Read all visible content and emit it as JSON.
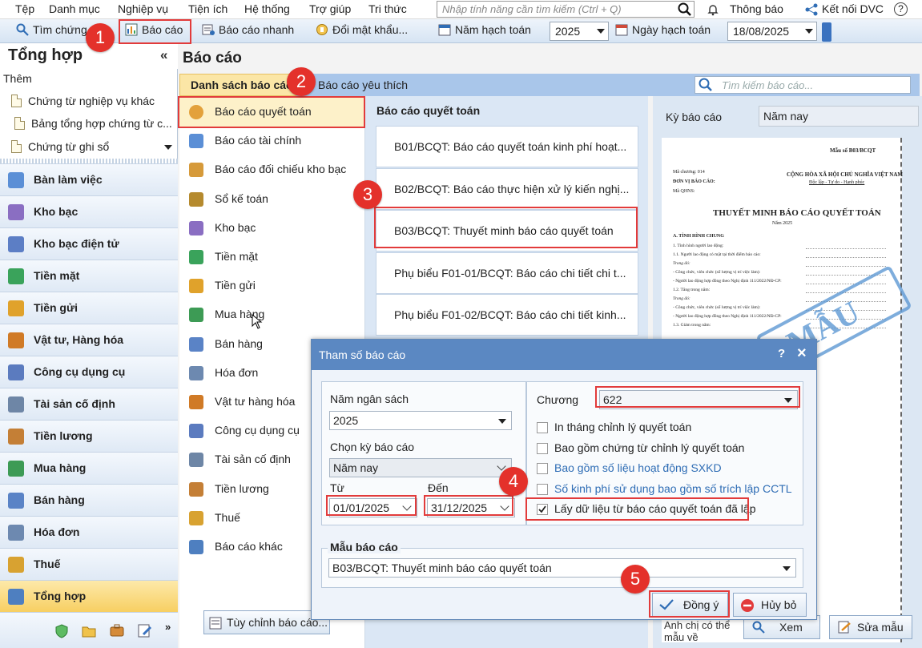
{
  "menu": {
    "items": [
      "Tệp",
      "Danh mục",
      "Nghiệp vụ",
      "Tiện ích",
      "Hệ thống",
      "Trợ giúp",
      "Tri thức"
    ],
    "search_placeholder": "Nhập tính năng cần tìm kiếm (Ctrl + Q)",
    "notifications": "Thông báo",
    "connect": "Kết nối DVC",
    "help_symbol": "?"
  },
  "toolbar": {
    "search_doc": "Tìm chứng",
    "report": "Báo cáo",
    "quick_report": "Báo cáo nhanh",
    "change_password": "Đổi mật khẩu...",
    "fiscal_year_label": "Năm hạch toán",
    "fiscal_year": "2025",
    "posting_date_label": "Ngày hạch toán",
    "posting_date": "18/08/2025"
  },
  "left_panel": {
    "title": "Tổng hợp",
    "collapse": "«",
    "add_label": "Thêm",
    "quick_items": [
      "Chứng từ nghiệp vụ khác",
      "Bảng tổng hợp chứng từ c...",
      "Chứng từ ghi sổ"
    ],
    "nav": [
      {
        "label": "Bàn làm việc",
        "color": "#5b8fd6"
      },
      {
        "label": "Kho bạc",
        "color": "#8a6ec2"
      },
      {
        "label": "Kho bạc điện tử",
        "color": "#5c7ec5"
      },
      {
        "label": "Tiền mặt",
        "color": "#3aa35b"
      },
      {
        "label": "Tiền gửi",
        "color": "#e0a22b"
      },
      {
        "label": "Vật tư, Hàng hóa",
        "color": "#d07a26"
      },
      {
        "label": "Công cụ dụng cụ",
        "color": "#5b7bbf"
      },
      {
        "label": "Tài sản cố định",
        "color": "#6e86a6"
      },
      {
        "label": "Tiền lương",
        "color": "#c47f36"
      },
      {
        "label": "Mua hàng",
        "color": "#3d9b55"
      },
      {
        "label": "Bán hàng",
        "color": "#5a83c6"
      },
      {
        "label": "Hóa đơn",
        "color": "#6d89b0"
      },
      {
        "label": "Thuế",
        "color": "#d8a231"
      },
      {
        "label": "Tổng hợp",
        "color": "#4e7fc0"
      }
    ]
  },
  "main": {
    "title": "Báo cáo",
    "tab_list": "Danh sách báo cáo",
    "tab_fav": "Báo cáo yêu thích",
    "search_placeholder": "Tìm kiếm báo cáo...",
    "categories": [
      "Báo cáo quyết toán",
      "Báo cáo tài chính",
      "Báo cáo đối chiếu kho bạc",
      "Sổ kế toán",
      "Kho bạc",
      "Tiền mặt",
      "Tiền gửi",
      "Mua hàng",
      "Bán hàng",
      "Hóa đơn",
      "Vật tư hàng hóa",
      "Công cụ dụng cụ",
      "Tài sản cố định",
      "Tiền lương",
      "Thuế",
      "Báo cáo khác"
    ],
    "customize": "Tùy chỉnh báo cáo...",
    "report_group_title": "Báo cáo quyết toán",
    "reports": [
      "B01/BCQT: Báo cáo quyết toán kinh phí hoạt...",
      "B02/BCQT: Báo cáo thực hiện xử lý kiến nghị...",
      "B03/BCQT: Thuyết minh báo cáo quyết toán",
      "Phụ biểu F01-01/BCQT: Báo cáo chi tiết chi t...",
      "Phụ biểu F01-02/BCQT: Báo cáo chi tiết kinh..."
    ],
    "period_label": "Kỳ báo cáo",
    "period_value": "Năm nay",
    "view_button": "Xem",
    "edit_template": "Sửa mẫu",
    "sample_hint": "Anh chị có thể mẫu về"
  },
  "preview": {
    "form_no": "Mẫu số B03/BCQT",
    "chapter_code": "Mã chương: 014",
    "unit": "ĐƠN VỊ BÁO CÁO:",
    "unit_code": "Mã QHNS:",
    "country": "CỘNG HÒA XÃ HỘI CHỦ NGHĨA VIỆT NAM",
    "motto": "Độc lập - Tự do - Hạnh phúc",
    "doc_title": "THUYẾT MINH BÁO CÁO QUYẾT TOÁN",
    "doc_year": "Năm 2025",
    "section_a": "A. TÌNH HÌNH CHUNG",
    "lines": [
      "1. Tình hình người lao động:",
      "1.1. Người lao động có mặt tại thời điểm báo cáo:",
      "Trong đó:",
      "- Công chức, viên chức (số lượng vị trí việc làm):",
      "- Người lao động hợp đồng theo Nghị định 111/2022/NĐ-CP:",
      "1.2. Tăng trong năm:",
      "Trong đó:",
      "- Công chức, viên chức (số lượng vị trí việc làm):",
      "- Người lao động hợp đồng theo Nghị định 111/2022/NĐ-CP:",
      "1.3. Giảm trong năm:"
    ],
    "watermark": "MẪU"
  },
  "dialog": {
    "title": "Tham số báo cáo",
    "help": "?",
    "close": "×",
    "budget_year_label": "Năm ngân sách",
    "budget_year": "2025",
    "period_label": "Chọn kỳ báo cáo",
    "period_value": "Năm nay",
    "from_label": "Từ",
    "from_value": "01/01/2025",
    "to_label": "Đến",
    "to_value": "31/12/2025",
    "chapter_label": "Chương",
    "chapter_value": "622",
    "options": [
      {
        "label": "In tháng chỉnh lý quyết toán",
        "checked": false,
        "style": "normal"
      },
      {
        "label": "Bao gồm chứng từ chỉnh lý quyết toán",
        "checked": false,
        "style": "normal"
      },
      {
        "label": "Bao gồm số liệu hoạt động SXKD",
        "checked": false,
        "style": "link"
      },
      {
        "label": "Số kinh phí sử dụng bao gồm số trích lập CCTL",
        "checked": false,
        "style": "link"
      },
      {
        "label": "Lấy dữ liệu từ báo cáo quyết toán đã lập",
        "checked": true,
        "style": "normal"
      }
    ],
    "template_label": "Mẫu báo cáo",
    "template_value": "B03/BCQT: Thuyết minh báo cáo quyết toán",
    "ok": "Đồng ý",
    "cancel": "Hủy bỏ"
  },
  "steps": [
    "1",
    "2",
    "3",
    "4",
    "5"
  ],
  "colors": {
    "highlight": "#e23b3b",
    "active_nav": "#f7cf62",
    "dialog_title": "#5b88c2"
  }
}
